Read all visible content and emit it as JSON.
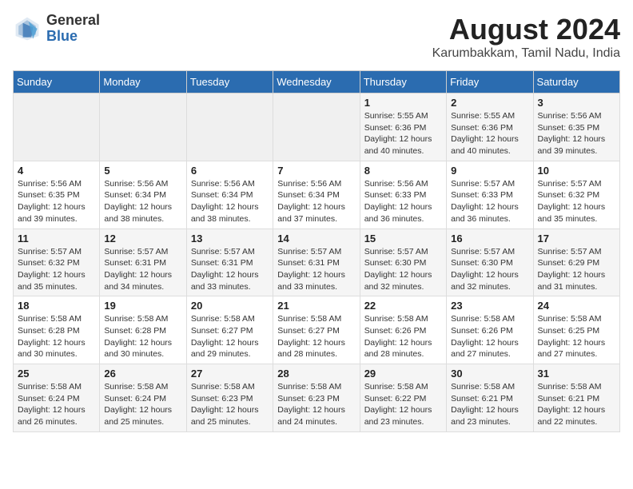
{
  "header": {
    "logo_line1": "General",
    "logo_line2": "Blue",
    "title": "August 2024",
    "subtitle": "Karumbakkam, Tamil Nadu, India"
  },
  "calendar": {
    "days_of_week": [
      "Sunday",
      "Monday",
      "Tuesday",
      "Wednesday",
      "Thursday",
      "Friday",
      "Saturday"
    ],
    "weeks": [
      [
        {
          "day": "",
          "info": ""
        },
        {
          "day": "",
          "info": ""
        },
        {
          "day": "",
          "info": ""
        },
        {
          "day": "",
          "info": ""
        },
        {
          "day": "1",
          "info": "Sunrise: 5:55 AM\nSunset: 6:36 PM\nDaylight: 12 hours\nand 40 minutes."
        },
        {
          "day": "2",
          "info": "Sunrise: 5:55 AM\nSunset: 6:36 PM\nDaylight: 12 hours\nand 40 minutes."
        },
        {
          "day": "3",
          "info": "Sunrise: 5:56 AM\nSunset: 6:35 PM\nDaylight: 12 hours\nand 39 minutes."
        }
      ],
      [
        {
          "day": "4",
          "info": "Sunrise: 5:56 AM\nSunset: 6:35 PM\nDaylight: 12 hours\nand 39 minutes."
        },
        {
          "day": "5",
          "info": "Sunrise: 5:56 AM\nSunset: 6:34 PM\nDaylight: 12 hours\nand 38 minutes."
        },
        {
          "day": "6",
          "info": "Sunrise: 5:56 AM\nSunset: 6:34 PM\nDaylight: 12 hours\nand 38 minutes."
        },
        {
          "day": "7",
          "info": "Sunrise: 5:56 AM\nSunset: 6:34 PM\nDaylight: 12 hours\nand 37 minutes."
        },
        {
          "day": "8",
          "info": "Sunrise: 5:56 AM\nSunset: 6:33 PM\nDaylight: 12 hours\nand 36 minutes."
        },
        {
          "day": "9",
          "info": "Sunrise: 5:57 AM\nSunset: 6:33 PM\nDaylight: 12 hours\nand 36 minutes."
        },
        {
          "day": "10",
          "info": "Sunrise: 5:57 AM\nSunset: 6:32 PM\nDaylight: 12 hours\nand 35 minutes."
        }
      ],
      [
        {
          "day": "11",
          "info": "Sunrise: 5:57 AM\nSunset: 6:32 PM\nDaylight: 12 hours\nand 35 minutes."
        },
        {
          "day": "12",
          "info": "Sunrise: 5:57 AM\nSunset: 6:31 PM\nDaylight: 12 hours\nand 34 minutes."
        },
        {
          "day": "13",
          "info": "Sunrise: 5:57 AM\nSunset: 6:31 PM\nDaylight: 12 hours\nand 33 minutes."
        },
        {
          "day": "14",
          "info": "Sunrise: 5:57 AM\nSunset: 6:31 PM\nDaylight: 12 hours\nand 33 minutes."
        },
        {
          "day": "15",
          "info": "Sunrise: 5:57 AM\nSunset: 6:30 PM\nDaylight: 12 hours\nand 32 minutes."
        },
        {
          "day": "16",
          "info": "Sunrise: 5:57 AM\nSunset: 6:30 PM\nDaylight: 12 hours\nand 32 minutes."
        },
        {
          "day": "17",
          "info": "Sunrise: 5:57 AM\nSunset: 6:29 PM\nDaylight: 12 hours\nand 31 minutes."
        }
      ],
      [
        {
          "day": "18",
          "info": "Sunrise: 5:58 AM\nSunset: 6:28 PM\nDaylight: 12 hours\nand 30 minutes."
        },
        {
          "day": "19",
          "info": "Sunrise: 5:58 AM\nSunset: 6:28 PM\nDaylight: 12 hours\nand 30 minutes."
        },
        {
          "day": "20",
          "info": "Sunrise: 5:58 AM\nSunset: 6:27 PM\nDaylight: 12 hours\nand 29 minutes."
        },
        {
          "day": "21",
          "info": "Sunrise: 5:58 AM\nSunset: 6:27 PM\nDaylight: 12 hours\nand 28 minutes."
        },
        {
          "day": "22",
          "info": "Sunrise: 5:58 AM\nSunset: 6:26 PM\nDaylight: 12 hours\nand 28 minutes."
        },
        {
          "day": "23",
          "info": "Sunrise: 5:58 AM\nSunset: 6:26 PM\nDaylight: 12 hours\nand 27 minutes."
        },
        {
          "day": "24",
          "info": "Sunrise: 5:58 AM\nSunset: 6:25 PM\nDaylight: 12 hours\nand 27 minutes."
        }
      ],
      [
        {
          "day": "25",
          "info": "Sunrise: 5:58 AM\nSunset: 6:24 PM\nDaylight: 12 hours\nand 26 minutes."
        },
        {
          "day": "26",
          "info": "Sunrise: 5:58 AM\nSunset: 6:24 PM\nDaylight: 12 hours\nand 25 minutes."
        },
        {
          "day": "27",
          "info": "Sunrise: 5:58 AM\nSunset: 6:23 PM\nDaylight: 12 hours\nand 25 minutes."
        },
        {
          "day": "28",
          "info": "Sunrise: 5:58 AM\nSunset: 6:23 PM\nDaylight: 12 hours\nand 24 minutes."
        },
        {
          "day": "29",
          "info": "Sunrise: 5:58 AM\nSunset: 6:22 PM\nDaylight: 12 hours\nand 23 minutes."
        },
        {
          "day": "30",
          "info": "Sunrise: 5:58 AM\nSunset: 6:21 PM\nDaylight: 12 hours\nand 23 minutes."
        },
        {
          "day": "31",
          "info": "Sunrise: 5:58 AM\nSunset: 6:21 PM\nDaylight: 12 hours\nand 22 minutes."
        }
      ]
    ]
  }
}
